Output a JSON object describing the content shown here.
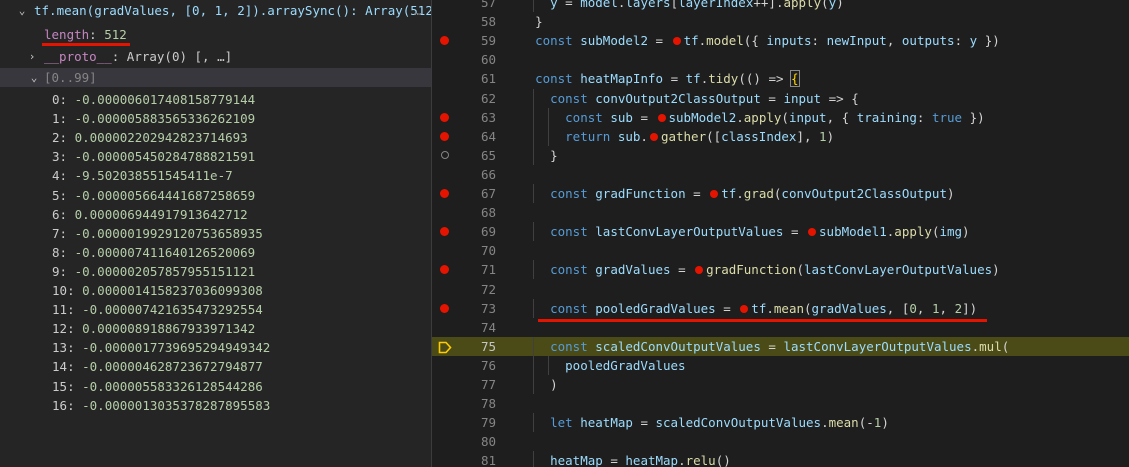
{
  "variables": {
    "header_label": "tf.mean(gradValues, [0, 1, 2]).arraySync(): Array(512)",
    "header_overflow": "…",
    "length_key": "length",
    "length_value": "512",
    "proto_key": "__proto__",
    "proto_value": "Array(0) [, …]",
    "group_label": "[0..99]",
    "items": [
      {
        "index": "0",
        "value": "-0.000006017408158779144"
      },
      {
        "index": "1",
        "value": "-0.0000058835653362621​09"
      },
      {
        "index": "2",
        "value": "0.0000022029428237146​93"
      },
      {
        "index": "3",
        "value": "-0.000005450284788821591"
      },
      {
        "index": "4",
        "value": "-9.502038551545411e-7"
      },
      {
        "index": "5",
        "value": "-0.000005664441687258659"
      },
      {
        "index": "6",
        "value": "0.000006944917913642712"
      },
      {
        "index": "7",
        "value": "-0.000001992912075365893​5"
      },
      {
        "index": "8",
        "value": "-0.000007411640126520069"
      },
      {
        "index": "9",
        "value": "-0.000002057857955151121"
      },
      {
        "index": "10",
        "value": "0.000001415823703609930​8"
      },
      {
        "index": "11",
        "value": "-0.000007421635473292554"
      },
      {
        "index": "12",
        "value": "0.000008918867933971342"
      },
      {
        "index": "13",
        "value": "-0.000001773969529494934​2"
      },
      {
        "index": "14",
        "value": "-0.000004628723672794877"
      },
      {
        "index": "15",
        "value": "-0.000005583326128544286"
      },
      {
        "index": "16",
        "value": "-0.000001303537828789558​3"
      }
    ]
  },
  "editor": {
    "lines": [
      {
        "num": "57",
        "text": "    y = model.layers[layerIndex++].apply(y)"
      },
      {
        "num": "58",
        "text": "  }"
      },
      {
        "num": "59",
        "text": "  const subModel2 = tf.model({ inputs: newInput, outputs: y })"
      },
      {
        "num": "60",
        "text": ""
      },
      {
        "num": "61",
        "text": "  const heatMapInfo = tf.tidy(() => {"
      },
      {
        "num": "62",
        "text": "    const convOutput2ClassOutput = input => {"
      },
      {
        "num": "63",
        "text": "      const sub = subModel2.apply(input, { training: true })"
      },
      {
        "num": "64",
        "text": "      return sub.gather([classIndex], 1)"
      },
      {
        "num": "65",
        "text": "    }"
      },
      {
        "num": "66",
        "text": ""
      },
      {
        "num": "67",
        "text": "    const gradFunction = tf.grad(convOutput2ClassOutput)"
      },
      {
        "num": "68",
        "text": ""
      },
      {
        "num": "69",
        "text": "    const lastConvLayerOutputValues = subModel1.apply(img)"
      },
      {
        "num": "70",
        "text": ""
      },
      {
        "num": "71",
        "text": "    const gradValues = gradFunction(lastConvLayerOutputValues)"
      },
      {
        "num": "72",
        "text": ""
      },
      {
        "num": "73",
        "text": "    const pooledGradValues = tf.mean(gradValues, [0, 1, 2])"
      },
      {
        "num": "74",
        "text": ""
      },
      {
        "num": "75",
        "text": "    const scaledConvOutputValues = lastConvLayerOutputValues.mul("
      },
      {
        "num": "76",
        "text": "      pooledGradValues"
      },
      {
        "num": "77",
        "text": "    )"
      },
      {
        "num": "78",
        "text": ""
      },
      {
        "num": "79",
        "text": "    let heatMap = scaledConvOutputValues.mean(-1)"
      },
      {
        "num": "80",
        "text": ""
      },
      {
        "num": "81",
        "text": "    heatMap = heatMap.relu()"
      }
    ]
  },
  "colors": {
    "breakpoint": "#e51400",
    "current_line": "#4b4b18",
    "keyword": "#569cd6",
    "function": "#dcdcaa",
    "variable": "#9cdcfe",
    "number": "#b5cea8"
  }
}
